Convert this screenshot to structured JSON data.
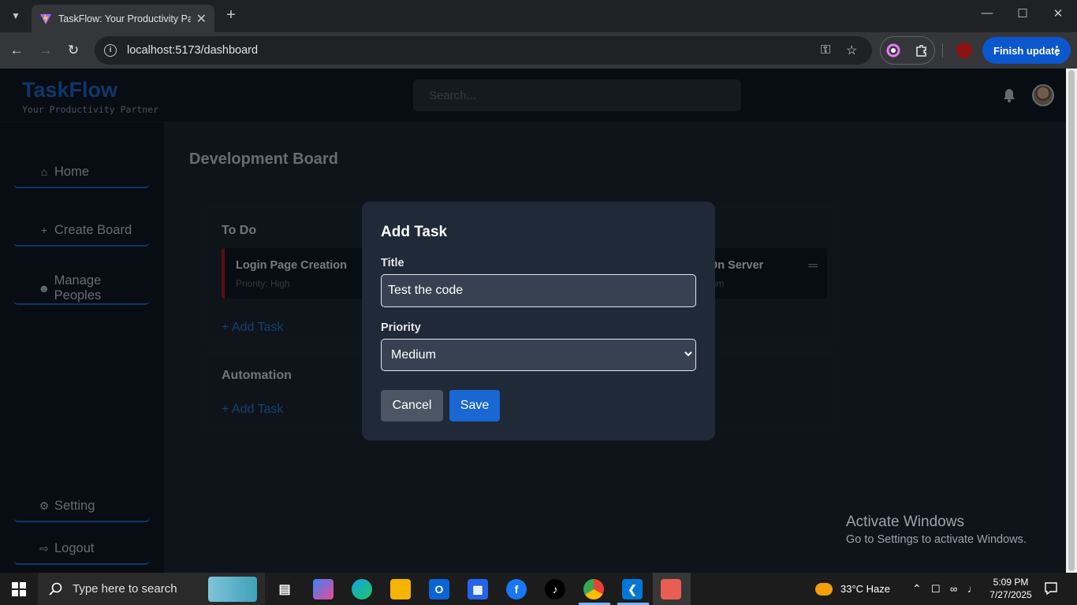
{
  "browser": {
    "tab_title": "TaskFlow: Your Productivity Part",
    "url": "localhost:5173/dashboard",
    "finish_update_label": "Finish update"
  },
  "app": {
    "logo": "TaskFlow",
    "tagline": "Your Productivity Partner",
    "search_placeholder": "Search...",
    "board_title": "Development Board",
    "sidebar": {
      "items": [
        {
          "label": "Home",
          "icon": "home-icon"
        },
        {
          "label": "Create Board",
          "icon": "plus-icon"
        },
        {
          "label": "Manage Peoples",
          "icon": "users-icon"
        }
      ],
      "bottom": [
        {
          "label": "Setting",
          "icon": "gear-icon"
        },
        {
          "label": "Logout",
          "icon": "logout-icon"
        }
      ]
    },
    "lists": [
      {
        "title": "To Do",
        "cards": [
          {
            "title": "Login Page Creation",
            "priority": "Priority: High"
          },
          {
            "title": "On Server",
            "priority": "ium"
          }
        ],
        "add_label": "+ Add Task"
      },
      {
        "title": "Automation",
        "cards": [],
        "add_label": "+ Add Task"
      }
    ]
  },
  "modal": {
    "title": "Add Task",
    "title_label": "Title",
    "title_value": "Test the code",
    "priority_label": "Priority",
    "priority_value": "Medium",
    "cancel_label": "Cancel",
    "save_label": "Save"
  },
  "watermark": {
    "line1": "Activate Windows",
    "line2": "Go to Settings to activate Windows."
  },
  "taskbar": {
    "search_text": "Type here to search",
    "weather": "33°C  Haze",
    "time": "5:09 PM",
    "date": "7/27/2025"
  },
  "colors": {
    "accent": "#1d6fd1",
    "priority_high": "#b91c1c",
    "save_button": "#1967d2"
  }
}
